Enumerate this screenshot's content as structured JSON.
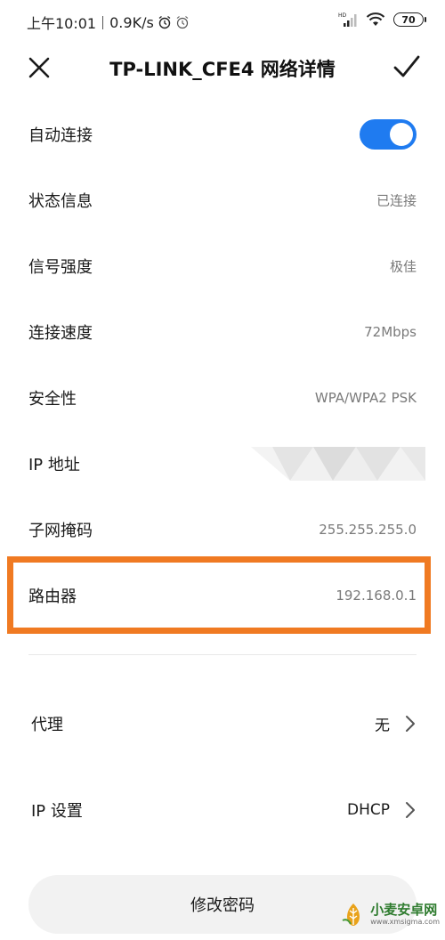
{
  "status_bar": {
    "time": "上午10:01",
    "speed": "0.9K/s",
    "network": "HD",
    "battery": "70"
  },
  "header": {
    "title": "TP-LINK_CFE4 网络详情",
    "close_icon": "close-icon",
    "confirm_icon": "check-icon"
  },
  "rows": [
    {
      "label": "自动连接",
      "toggle_on": true
    },
    {
      "label": "状态信息",
      "value": "已连接"
    },
    {
      "label": "信号强度",
      "value": "极佳"
    },
    {
      "label": "连接速度",
      "value": "72Mbps"
    },
    {
      "label": "安全性",
      "value": "WPA/WPA2 PSK"
    },
    {
      "label": "IP 地址",
      "value_obscured": true
    },
    {
      "label": "子网掩码",
      "value": "255.255.255.0"
    },
    {
      "label": "路由器",
      "value": "192.168.0.1"
    }
  ],
  "nav": [
    {
      "label": "代理",
      "value": "无"
    },
    {
      "label": "IP 设置",
      "value": "DHCP"
    }
  ],
  "password_button": "修改密码",
  "watermark": {
    "name": "小麦安卓网",
    "url": "www.xmsigma.com"
  },
  "colors": {
    "accent": "#1f7bf0",
    "highlight": "#f07a22",
    "value_gray": "#7a7a7a"
  }
}
